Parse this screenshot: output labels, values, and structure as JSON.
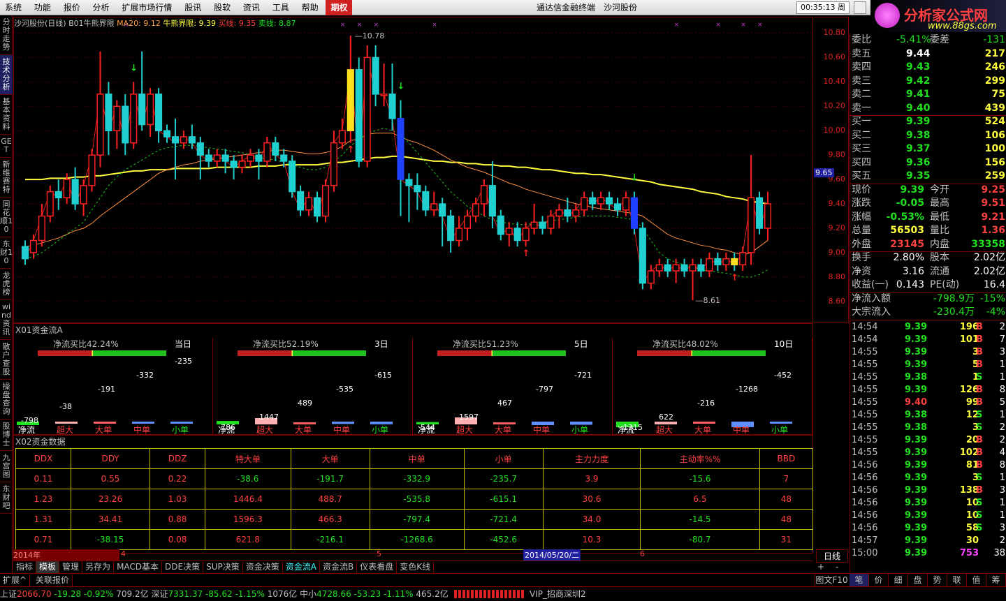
{
  "menu": {
    "items": [
      "系统",
      "功能",
      "报价",
      "分析",
      "扩展市场行情",
      "股讯",
      "股软",
      "资讯",
      "工具",
      "帮助",
      "期权"
    ],
    "title": "通达信金融终端　沙河股份",
    "time": "00:35:13 周三",
    "logo_text": "分析家公式网",
    "logo_url": "www.88gs.com"
  },
  "sidebar": [
    "分时走势",
    "技术分析",
    "基本资料",
    "GET",
    "新维赛特",
    "同花顺10",
    "东财10",
    "龙虎榜",
    "wind资讯",
    "散户查股",
    "操盘查询",
    "股博士",
    "九宫图",
    "东财吧"
  ],
  "chart_header": {
    "name": "沙河股份(日线)",
    "indicator": "B01牛熊界限",
    "ma20": "MA20: 9.12",
    "bull": "牛熊界限: 9.39",
    "buy": "买线: 9.35",
    "sell": "卖线: 8.87"
  },
  "chart_data": {
    "type": "candlestick",
    "ylim": [
      8.45,
      10.9
    ],
    "yticks": [
      "10.80",
      "10.60",
      "10.40",
      "10.20",
      "10.00",
      "9.80",
      "9.60",
      "9.40",
      "9.20",
      "9.00",
      "8.80",
      "8.60"
    ],
    "current_price_label": "9.65",
    "high_label": "10.78",
    "low_label": "8.61",
    "candles": [
      [
        9.05,
        8.95,
        9.1,
        8.9
      ],
      [
        9.0,
        9.1,
        9.15,
        8.95
      ],
      [
        9.1,
        9.3,
        9.4,
        9.05
      ],
      [
        9.3,
        9.5,
        9.55,
        9.25
      ],
      [
        9.5,
        9.45,
        9.6,
        9.35
      ],
      [
        9.45,
        9.6,
        9.65,
        9.4
      ],
      [
        9.6,
        9.4,
        9.7,
        9.35
      ],
      [
        9.4,
        9.55,
        9.6,
        9.3
      ],
      [
        9.55,
        9.8,
        9.85,
        9.5
      ],
      [
        9.8,
        10.3,
        10.65,
        9.7
      ],
      [
        10.3,
        10.0,
        10.4,
        9.8
      ],
      [
        10.0,
        10.2,
        10.25,
        9.85
      ],
      [
        10.2,
        9.9,
        10.3,
        9.8
      ],
      [
        9.9,
        10.3,
        10.4,
        9.85
      ],
      [
        10.3,
        10.05,
        10.65,
        10.0
      ],
      [
        10.05,
        10.3,
        10.35,
        9.95
      ],
      [
        10.3,
        10.0,
        10.35,
        9.9
      ],
      [
        10.0,
        9.95,
        10.05,
        9.9
      ],
      [
        9.95,
        9.9,
        10.1,
        9.6
      ],
      [
        9.9,
        9.95,
        10.0,
        9.85
      ],
      [
        9.95,
        9.9,
        10.05,
        9.85
      ],
      [
        9.9,
        9.8,
        9.95,
        9.6
      ],
      [
        9.8,
        9.75,
        9.85,
        9.7
      ],
      [
        9.75,
        9.8,
        9.85,
        9.7
      ],
      [
        9.8,
        9.75,
        9.85,
        9.65
      ],
      [
        9.75,
        9.7,
        9.8,
        9.6
      ],
      [
        9.7,
        9.75,
        9.8,
        9.65
      ],
      [
        9.75,
        9.8,
        9.85,
        9.7
      ],
      [
        9.8,
        9.75,
        9.85,
        9.6
      ],
      [
        9.75,
        9.9,
        9.95,
        9.7
      ],
      [
        9.9,
        9.8,
        9.95,
        9.75
      ],
      [
        9.8,
        9.75,
        9.85,
        9.7
      ],
      [
        9.75,
        9.5,
        9.8,
        9.45
      ],
      [
        9.5,
        9.35,
        9.55,
        9.3
      ],
      [
        9.35,
        9.45,
        9.5,
        9.3
      ],
      [
        9.45,
        9.3,
        9.5,
        9.25
      ],
      [
        9.3,
        9.55,
        9.6,
        9.25
      ],
      [
        9.55,
        9.9,
        10.0,
        9.5
      ],
      [
        9.9,
        10.0,
        10.1,
        9.85
      ],
      [
        10.0,
        10.5,
        10.78,
        9.9
      ],
      [
        10.5,
        9.75,
        10.6,
        9.7
      ],
      [
        9.75,
        10.6,
        10.7,
        9.7
      ],
      [
        10.6,
        10.3,
        10.7,
        10.2
      ],
      [
        10.3,
        10.3,
        10.55,
        10.2
      ],
      [
        10.3,
        10.1,
        10.55,
        10.0
      ],
      [
        10.1,
        9.6,
        10.25,
        9.3
      ],
      [
        9.6,
        9.55,
        9.65,
        9.25
      ],
      [
        9.55,
        9.5,
        9.65,
        9.35
      ],
      [
        9.5,
        9.35,
        9.55,
        9.3
      ],
      [
        9.35,
        9.4,
        9.5,
        9.3
      ],
      [
        9.4,
        9.3,
        9.45,
        9.05
      ],
      [
        9.3,
        9.1,
        9.35,
        9.0
      ],
      [
        9.1,
        9.2,
        9.3,
        9.05
      ],
      [
        9.2,
        9.3,
        9.35,
        9.1
      ],
      [
        9.3,
        9.4,
        9.45,
        9.25
      ],
      [
        9.4,
        9.55,
        9.6,
        9.3
      ],
      [
        9.55,
        9.3,
        9.75,
        9.2
      ],
      [
        9.3,
        9.15,
        9.35,
        9.1
      ],
      [
        9.15,
        9.2,
        9.25,
        9.05
      ],
      [
        9.2,
        9.1,
        9.25,
        9.05
      ],
      [
        9.1,
        9.2,
        9.25,
        9.05
      ],
      [
        9.2,
        9.25,
        9.4,
        9.15
      ],
      [
        9.25,
        9.2,
        9.3,
        9.15
      ],
      [
        9.2,
        9.3,
        9.35,
        9.15
      ],
      [
        9.3,
        9.35,
        9.4,
        9.2
      ],
      [
        9.35,
        9.3,
        9.45,
        9.25
      ],
      [
        9.3,
        9.35,
        9.4,
        9.25
      ],
      [
        9.35,
        9.45,
        9.5,
        9.3
      ],
      [
        9.45,
        9.4,
        9.5,
        9.35
      ],
      [
        9.4,
        9.45,
        9.5,
        9.35
      ],
      [
        9.45,
        9.4,
        9.5,
        9.35
      ],
      [
        9.4,
        9.35,
        9.45,
        9.3
      ],
      [
        9.35,
        9.45,
        9.5,
        9.3
      ],
      [
        9.45,
        9.2,
        9.5,
        9.15
      ],
      [
        9.2,
        8.75,
        9.25,
        8.7
      ],
      [
        8.75,
        8.85,
        8.9,
        8.7
      ],
      [
        8.85,
        8.9,
        8.95,
        8.8
      ],
      [
        8.9,
        8.85,
        8.95,
        8.8
      ],
      [
        8.85,
        8.9,
        8.95,
        8.75
      ],
      [
        8.9,
        8.85,
        8.95,
        8.8
      ],
      [
        8.85,
        8.9,
        8.95,
        8.61
      ],
      [
        8.9,
        8.85,
        8.95,
        8.8
      ],
      [
        8.85,
        8.95,
        9.0,
        8.8
      ],
      [
        8.95,
        8.9,
        9.0,
        8.85
      ],
      [
        8.9,
        8.95,
        9.0,
        8.85
      ],
      [
        8.95,
        8.9,
        9.0,
        8.85
      ],
      [
        8.9,
        9.0,
        9.05,
        8.85
      ],
      [
        9.0,
        9.45,
        9.8,
        8.9
      ],
      [
        9.45,
        9.2,
        9.5,
        9.15
      ],
      [
        9.2,
        9.4,
        9.5,
        9.1
      ]
    ],
    "ma20": [
      9.05,
      9.06,
      9.08,
      9.1,
      9.12,
      9.15,
      9.18,
      9.2,
      9.24,
      9.3,
      9.35,
      9.4,
      9.45,
      9.5,
      9.55,
      9.6,
      9.65,
      9.68,
      9.7,
      9.72,
      9.73,
      9.75,
      9.76,
      9.77,
      9.78,
      9.79,
      9.8,
      9.81,
      9.82,
      9.83,
      9.84,
      9.84,
      9.83,
      9.82,
      9.81,
      9.81,
      9.82,
      9.84,
      9.87,
      9.92,
      9.93,
      9.97,
      9.98,
      9.98,
      9.98,
      9.95,
      9.92,
      9.9,
      9.87,
      9.84,
      9.8,
      9.76,
      9.73,
      9.7,
      9.68,
      9.66,
      9.63,
      9.6,
      9.57,
      9.55,
      9.52,
      9.5,
      9.48,
      9.46,
      9.44,
      9.42,
      9.4,
      9.39,
      9.37,
      9.36,
      9.35,
      9.34,
      9.33,
      9.32,
      9.3,
      9.25,
      9.2,
      9.15,
      9.12,
      9.1,
      9.08,
      9.06,
      9.05,
      9.03,
      9.02,
      9.0,
      8.98,
      9.0,
      9.05,
      9.1
    ],
    "bull": [
      9.6,
      9.6,
      9.6,
      9.61,
      9.61,
      9.61,
      9.62,
      9.62,
      9.63,
      9.63,
      9.64,
      9.65,
      9.66,
      9.67,
      9.67,
      9.68,
      9.68,
      9.68,
      9.69,
      9.69,
      9.69,
      9.69,
      9.69,
      9.7,
      9.7,
      9.7,
      9.7,
      9.7,
      9.71,
      9.71,
      9.71,
      9.72,
      9.72,
      9.72,
      9.72,
      9.72,
      9.73,
      9.74,
      9.74,
      9.75,
      9.76,
      9.77,
      9.78,
      9.78,
      9.79,
      9.79,
      9.78,
      9.77,
      9.76,
      9.75,
      9.75,
      9.74,
      9.74,
      9.73,
      9.73,
      9.72,
      9.72,
      9.71,
      9.71,
      9.7,
      9.7,
      9.69,
      9.68,
      9.68,
      9.67,
      9.66,
      9.65,
      9.65,
      9.64,
      9.64,
      9.63,
      9.62,
      9.61,
      9.6,
      9.59,
      9.58,
      9.56,
      9.55,
      9.54,
      9.53,
      9.52,
      9.5,
      9.49,
      9.48,
      9.46,
      9.45,
      9.44,
      9.42,
      9.41,
      9.4
    ],
    "buyline": [
      8.95,
      8.97,
      9.0,
      9.05,
      9.1,
      9.15,
      9.2,
      9.25,
      9.35,
      9.45,
      9.55,
      9.62,
      9.68,
      9.72,
      9.76,
      9.8,
      9.84,
      9.86,
      9.87,
      9.88,
      9.88,
      9.87,
      9.86,
      9.85,
      9.84,
      9.83,
      9.82,
      9.8,
      9.78,
      9.77,
      9.76,
      9.74,
      9.72,
      9.7,
      9.68,
      9.68,
      9.7,
      9.75,
      9.8,
      9.88,
      9.92,
      9.98,
      10.0,
      10.02,
      10.0,
      9.97,
      9.9,
      9.82,
      9.74,
      9.66,
      9.58,
      9.5,
      9.44,
      9.38,
      9.34,
      9.3,
      9.27,
      9.25,
      9.24,
      9.23,
      9.23,
      9.24,
      9.25,
      9.26,
      9.27,
      9.28,
      9.29,
      9.3,
      9.3,
      9.3,
      9.3,
      9.29,
      9.28,
      9.27,
      9.2,
      9.1,
      9.0,
      8.95,
      8.92,
      8.9,
      8.88,
      8.86,
      8.85,
      8.84,
      8.83,
      8.82,
      8.8,
      8.8,
      8.82,
      8.86
    ]
  },
  "flowA": {
    "title": "X01资金流A",
    "boxes": [
      {
        "ratio": "净流买比42.24%",
        "period": "当日",
        "vals": [
          "-798",
          "-38",
          "-191",
          "-332",
          "-235"
        ]
      },
      {
        "ratio": "净流买比52.19%",
        "period": "3日",
        "vals": [
          "786",
          "1447",
          "489",
          "-535",
          "-615"
        ]
      },
      {
        "ratio": "净流买比51.23%",
        "period": "5日",
        "vals": [
          "544",
          "1597",
          "467",
          "-797",
          "-721"
        ]
      },
      {
        "ratio": "净流买比48.02%",
        "period": "10日",
        "vals": [
          "-1315",
          "622",
          "-216",
          "-1268",
          "-452"
        ]
      }
    ],
    "cats": [
      "净流",
      "超大",
      "大单",
      "中单",
      "小单"
    ]
  },
  "flowB": {
    "title": "X02资金数据",
    "headers": [
      "DDX",
      "DDY",
      "DDZ",
      "特大单",
      "大单",
      "中单",
      "小单",
      "主力力度",
      "主动率%%",
      "BBD"
    ],
    "rows": [
      [
        "0.11",
        "0.55",
        "0.22",
        "-38.6",
        "-191.7",
        "-332.9",
        "-235.7",
        "3.9",
        "-15.6",
        "7"
      ],
      [
        "1.23",
        "23.26",
        "1.03",
        "1446.4",
        "488.7",
        "-535.8",
        "-615.1",
        "30.6",
        "6.5",
        "48"
      ],
      [
        "1.31",
        "34.41",
        "0.88",
        "1596.3",
        "466.3",
        "-797.4",
        "-721.4",
        "34.0",
        "-14.5",
        "48"
      ],
      [
        "0.71",
        "-38.15",
        "0.08",
        "621.8",
        "-216.1",
        "-1268.6",
        "-452.6",
        "10.3",
        "-80.7",
        "31"
      ]
    ]
  },
  "dateaxis": {
    "year": "2014年",
    "m4": "4",
    "m5": "5",
    "date": "2014/05/20/二",
    "m6": "6",
    "period": "日线"
  },
  "tabs": [
    "指标",
    "模板",
    "管理",
    "另存为",
    "MACD基本",
    "DDE决策",
    "SUP决策",
    "资金决策",
    "资金流A",
    "资金流B",
    "仪表看盘",
    "变色K线"
  ],
  "tabs2": [
    "扩展^",
    "关联报价"
  ],
  "quote": {
    "webi_label": "委比",
    "webi": "-5.41%",
    "weicha_label": "委差",
    "weicha": "-131",
    "asks": [
      [
        "卖五",
        "9.44",
        "217"
      ],
      [
        "卖四",
        "9.43",
        "246"
      ],
      [
        "卖三",
        "9.42",
        "299"
      ],
      [
        "卖二",
        "9.41",
        "75"
      ],
      [
        "卖一",
        "9.40",
        "439"
      ]
    ],
    "bids": [
      [
        "买一",
        "9.39",
        "524"
      ],
      [
        "买二",
        "9.38",
        "106"
      ],
      [
        "买三",
        "9.37",
        "100"
      ],
      [
        "买四",
        "9.36",
        "156"
      ],
      [
        "买五",
        "9.35",
        "259"
      ]
    ],
    "stats": [
      [
        "现价",
        "9.39",
        "今开",
        "9.25"
      ],
      [
        "涨跌",
        "-0.05",
        "最高",
        "9.51"
      ],
      [
        "涨幅",
        "-0.53%",
        "最低",
        "9.21"
      ],
      [
        "总量",
        "56503",
        "量比",
        "1.36"
      ],
      [
        "外盘",
        "23145",
        "内盘",
        "33358"
      ]
    ],
    "stats2": [
      [
        "换手",
        "2.80%",
        "股本",
        "2.02亿"
      ],
      [
        "净资",
        "3.16",
        "流通",
        "2.02亿"
      ],
      [
        "收益(一)",
        "0.143",
        "PE(动)",
        "16.4"
      ]
    ],
    "flow": [
      [
        "净流入额",
        "-798.9万",
        "-15%"
      ],
      [
        "大宗流入",
        "-230.4万",
        "-4%"
      ]
    ],
    "ticks": [
      [
        "14:54",
        "9.39",
        "196",
        "B"
      ],
      [
        "14:54",
        "9.39",
        "101",
        "B"
      ],
      [
        "14:55",
        "9.39",
        "3",
        "B"
      ],
      [
        "14:55",
        "9.39",
        "5",
        "B"
      ],
      [
        "14:55",
        "9.38",
        "1",
        "S"
      ],
      [
        "14:55",
        "9.39",
        "126",
        "B"
      ],
      [
        "14:55",
        "9.40",
        "99",
        "B"
      ],
      [
        "14:55",
        "9.38",
        "12",
        "S"
      ],
      [
        "14:55",
        "9.38",
        "3",
        "S"
      ],
      [
        "14:55",
        "9.39",
        "20",
        "B"
      ],
      [
        "14:55",
        "9.39",
        "102",
        "B"
      ],
      [
        "14:56",
        "9.39",
        "81",
        "B"
      ],
      [
        "14:56",
        "9.39",
        "3",
        "S"
      ],
      [
        "14:56",
        "9.39",
        "138",
        "B"
      ],
      [
        "14:56",
        "9.39",
        "10",
        "S"
      ],
      [
        "14:56",
        "9.39",
        "10",
        "S"
      ],
      [
        "14:56",
        "9.39",
        "58",
        "S"
      ],
      [
        "14:57",
        "9.39",
        "30",
        ""
      ],
      [
        "15:00",
        "9.39",
        "753",
        ""
      ]
    ],
    "tick_counts": [
      "2",
      "7",
      "3",
      "1",
      "1",
      "8",
      "5",
      "1",
      "2",
      "2",
      "4",
      "8",
      "1",
      "3",
      "1",
      "1",
      "3",
      "2",
      "38"
    ],
    "bottom_tabs": [
      "笔",
      "价",
      "细",
      "盘",
      "势",
      "联",
      "值",
      "筹"
    ],
    "period_label": "日线",
    "tuwen": "图文F10"
  },
  "status": {
    "sh": "上证",
    "sh_val": "2066.70",
    "sh_chg": "-19.28",
    "sh_pct": "-0.92%",
    "sh_amt": "709.2亿",
    "sz": "深证",
    "sz_val": "7331.37",
    "sz_chg": "-85.62",
    "sz_pct": "-1.15%",
    "sz_amt": "1076亿",
    "zx": "中小",
    "zx_val": "4728.66",
    "zx_chg": "-53.23",
    "zx_pct": "-1.11%",
    "zx_amt": "465.2亿",
    "vip": "VIP_招商深圳2"
  }
}
